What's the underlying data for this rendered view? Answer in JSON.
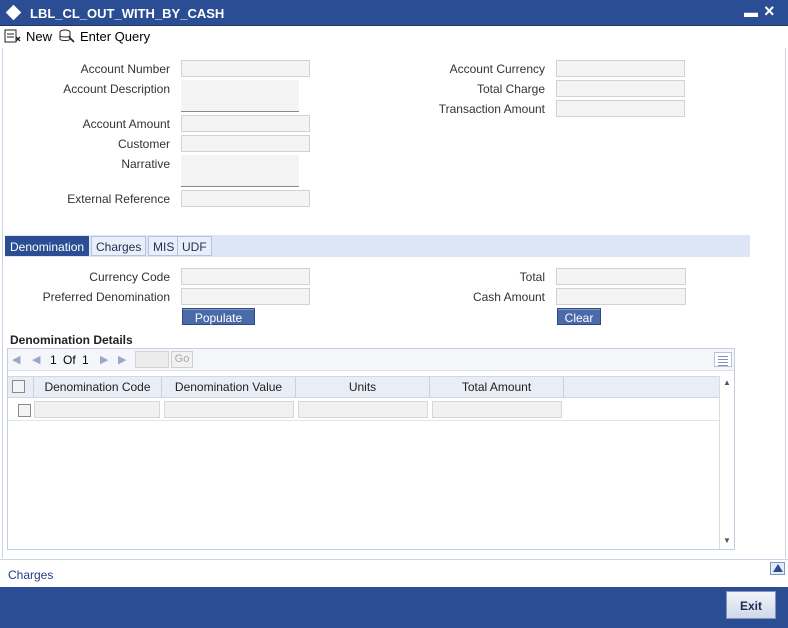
{
  "window": {
    "title": "LBL_CL_OUT_WITH_BY_CASH"
  },
  "toolbar": {
    "new_label": "New",
    "enter_query_label": "Enter Query"
  },
  "form": {
    "account_number_label": "Account Number",
    "account_description_label": "Account Description",
    "account_amount_label": "Account Amount",
    "customer_label": "Customer",
    "narrative_label": "Narrative",
    "external_reference_label": "External Reference",
    "account_currency_label": "Account Currency",
    "total_charge_label": "Total Charge",
    "transaction_amount_label": "Transaction Amount"
  },
  "tabs": [
    {
      "label": "Denomination",
      "active": true
    },
    {
      "label": "Charges",
      "active": false
    },
    {
      "label": "MIS",
      "active": false
    },
    {
      "label": "UDF",
      "active": false
    }
  ],
  "denomination": {
    "currency_code_label": "Currency Code",
    "preferred_denomination_label": "Preferred Denomination",
    "total_label": "Total",
    "cash_amount_label": "Cash Amount",
    "populate_label": "Populate",
    "clear_label": "Clear",
    "details_title": "Denomination Details",
    "pager": {
      "current": "1",
      "of_label": "Of",
      "total": "1",
      "go_label": "Go"
    },
    "columns": [
      "Denomination Code",
      "Denomination Value",
      "Units",
      "Total Amount"
    ]
  },
  "footer": {
    "charges_link": "Charges",
    "exit_label": "Exit"
  },
  "colors": {
    "brand_blue": "#2a4d93",
    "button_blue": "#4b6aa8"
  }
}
